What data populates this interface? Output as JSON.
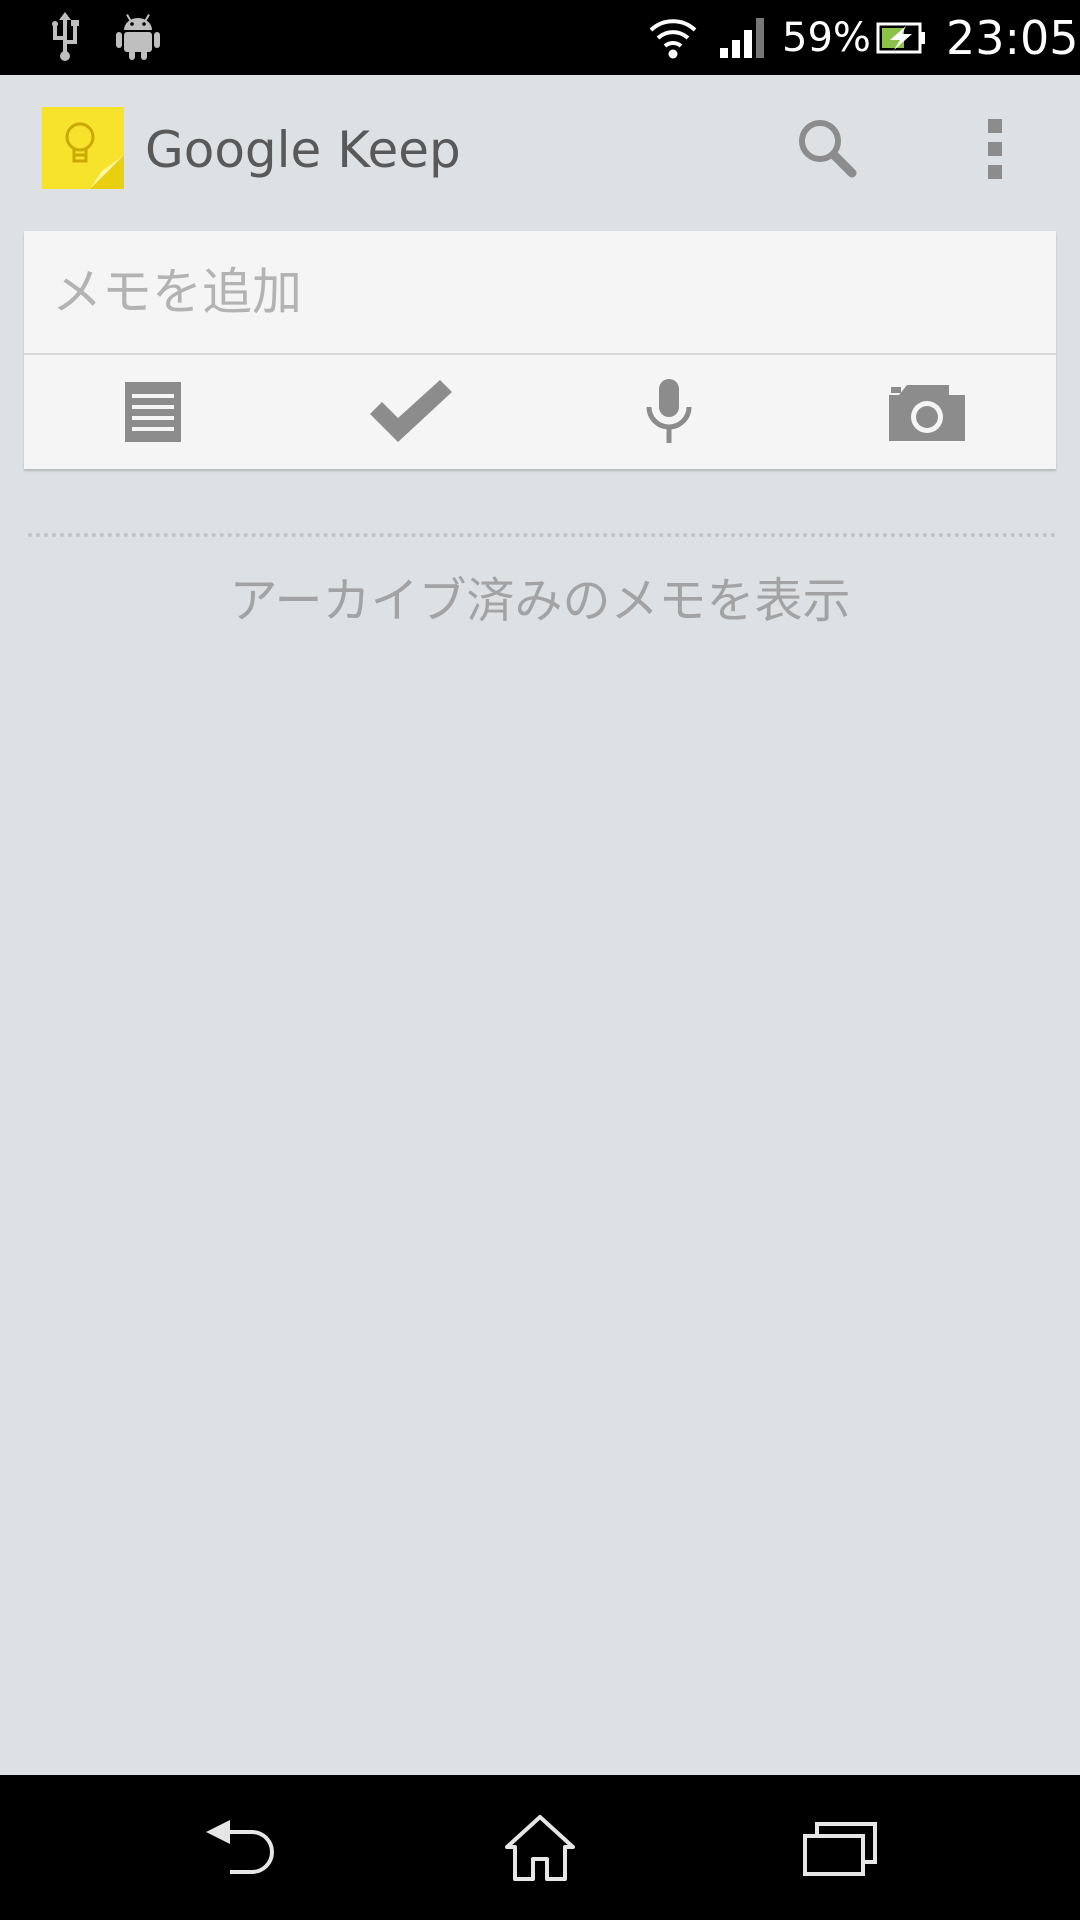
{
  "status_bar": {
    "battery_percent": "59%",
    "time": "23:05",
    "icons": [
      "usb-icon",
      "android-debug-icon",
      "wifi-icon",
      "signal-icon",
      "battery-charging-icon"
    ]
  },
  "action_bar": {
    "title": "Google Keep",
    "logo_icon": "keep-lightbulb-icon",
    "search_icon": "search-icon",
    "overflow_icon": "overflow-menu-icon"
  },
  "note_card": {
    "placeholder": "メモを追加",
    "value": "",
    "buttons": [
      {
        "name": "text-note-button",
        "icon": "text-note-icon"
      },
      {
        "name": "checklist-button",
        "icon": "checkmark-icon"
      },
      {
        "name": "voice-note-button",
        "icon": "microphone-icon"
      },
      {
        "name": "photo-note-button",
        "icon": "camera-icon"
      }
    ]
  },
  "archived": {
    "label": "アーカイブ済みのメモを表示"
  },
  "nav_bar": {
    "buttons": [
      "back-icon",
      "home-icon",
      "recent-apps-icon"
    ]
  },
  "colors": {
    "background": "#dde1e4",
    "card": "#f5f5f5",
    "keep_yellow": "#f5e12a",
    "icon_gray": "#8c8c8c"
  }
}
